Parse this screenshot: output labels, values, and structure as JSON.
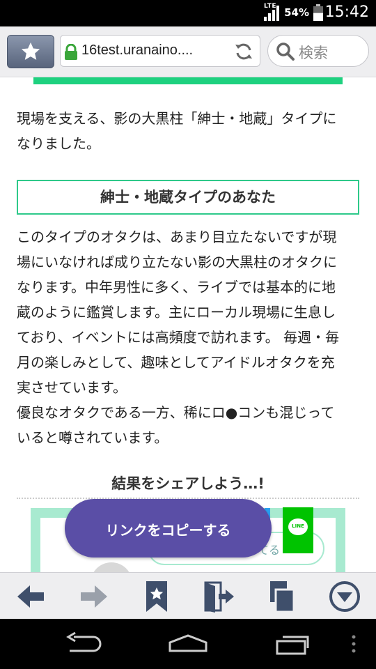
{
  "status_bar": {
    "network": "LTE",
    "battery_percent": "54%",
    "battery_level": 0.54,
    "time": "15:42"
  },
  "browser": {
    "url": "16test.uranaino....",
    "search_placeholder": "検索"
  },
  "article": {
    "intro_lines": [
      "現場を支える、影の大黒柱「紳士・地蔵」タイプに",
      "なりました。"
    ],
    "heading": "紳士・地蔵タイプのあなた",
    "body_lines": [
      "このタイプのオタクは、あまり目立たないですが現",
      "場にいなければ成り立たない影の大黒柱のオタクに",
      "なります。中年男性に多く、ライブでは基本的に地",
      "蔵のように鑑賞します。主にローカル現場に生息し",
      "ており、イベントには高頻度で訪れます。 毎週・毎",
      "月の楽しみとして、趣味としてアイドルオタクを充",
      "実させています。",
      "優良なオタクである一方、稀にロ●コンも混じって",
      "いると噂されています。"
    ]
  },
  "share": {
    "title": "結果をシェアしよう…!",
    "copy_button_label": "リンクをコピーする",
    "partial_button_text": "てる",
    "line_label": "LINE"
  },
  "colors": {
    "accent_green": "#1ed17f",
    "copy_button": "#5a4ea6",
    "line_green": "#00c300"
  },
  "icons": {
    "toolbar": [
      "star-icon",
      "lock-icon",
      "reload-icon",
      "search-icon"
    ],
    "bottom": [
      "back-arrow-icon",
      "forward-arrow-icon",
      "bookmark-icon",
      "exit-door-icon",
      "tabs-icon",
      "menu-down-icon"
    ],
    "nav": [
      "nav-back-icon",
      "nav-home-icon",
      "nav-recents-icon",
      "nav-menu-icon"
    ]
  }
}
